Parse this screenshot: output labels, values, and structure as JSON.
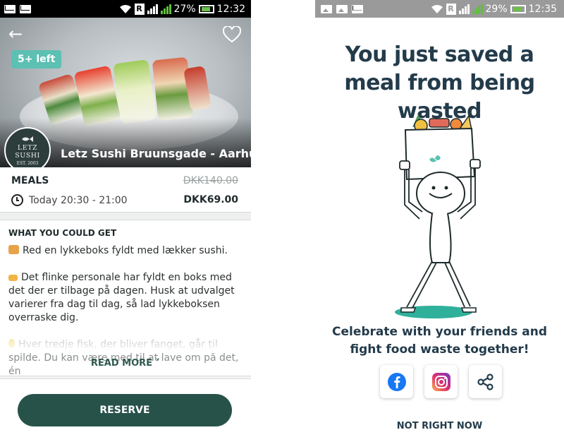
{
  "left_screen": {
    "status_bar": {
      "battery": "27%",
      "time": "12:32",
      "carrier_badge": "R"
    },
    "listing": {
      "badge": "5+ left",
      "logo_text": "LETZ SUSHI",
      "logo_est": "EST. 2003",
      "store_name": "Letz Sushi Bruunsgade - Aarhus C"
    },
    "meals": {
      "title": "MEALS",
      "original_price": "DKK140.00",
      "pickup_time": "Today 20:30 - 21:00",
      "price": "DKK69.00"
    },
    "what_you_get": {
      "title": "WHAT YOU COULD GET",
      "paragraphs": [
        "Red en lykkeboks fyldt med lækker sushi.",
        "Det flinke personale har fyldt en boks med det der er tilbage på dagen. Husk at udvalget varierer fra dag til dag, så lad lykkeboksen overraske dig.",
        "Hver tredje fisk, der bliver fanget, går til spilde. Du kan være med til at lave om på det, én"
      ],
      "read_more": "READ MORE ˅"
    },
    "reserve_label": "RESERVE",
    "colors": {
      "accent": "#27524a",
      "badge": "#5cc0b3"
    }
  },
  "right_screen": {
    "status_bar": {
      "battery": "29%",
      "time": "12:35",
      "carrier_badge": "R"
    },
    "title": "You just saved a meal from being wasted",
    "celebrate_text": "Celebrate with your friends and fight food waste together!",
    "share_buttons": [
      "facebook-icon",
      "instagram-icon",
      "share-icon"
    ],
    "not_now": "NOT RIGHT NOW",
    "colors": {
      "title": "#233b4b",
      "shadow": "#2fb09a"
    }
  }
}
